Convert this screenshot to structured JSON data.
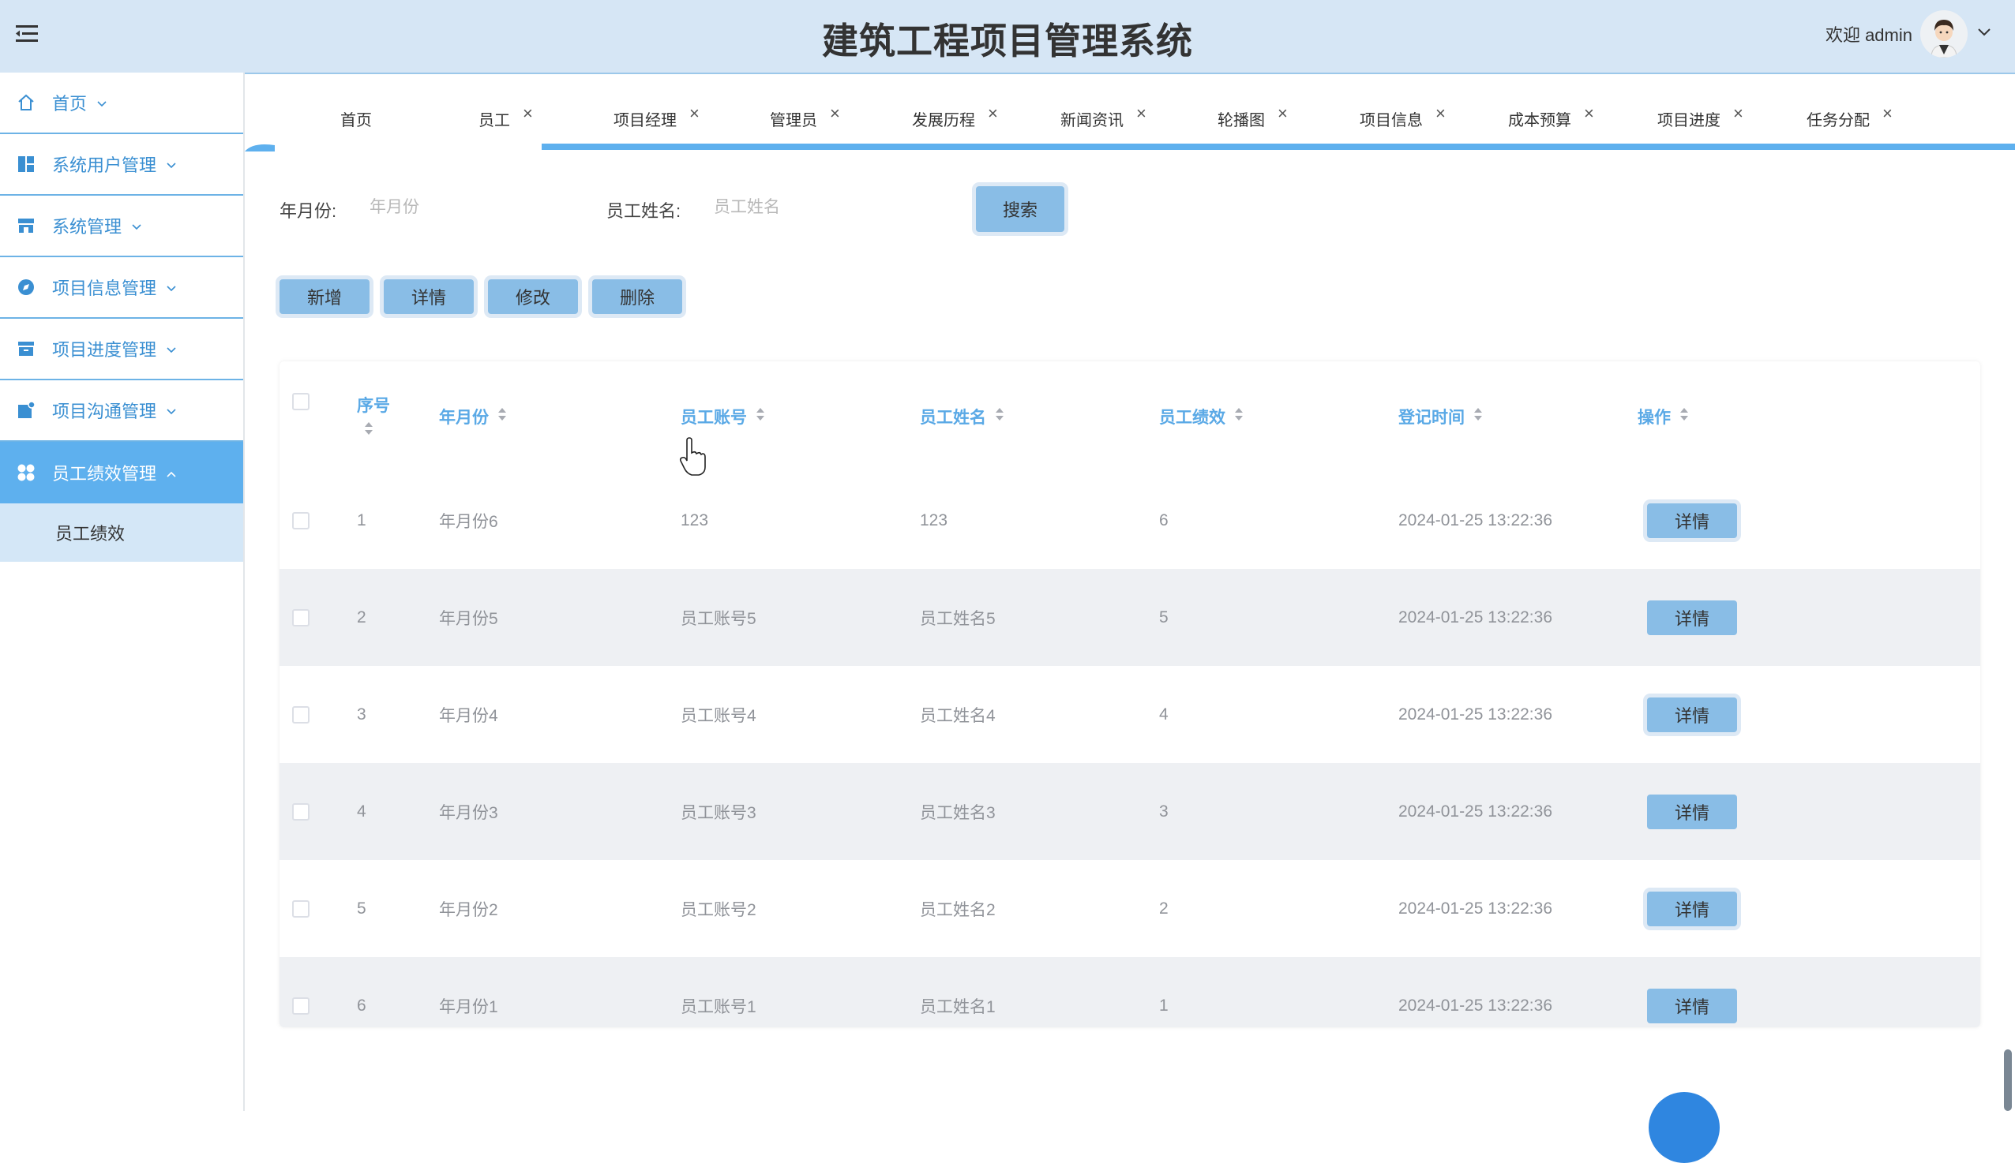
{
  "header": {
    "title": "建筑工程项目管理系统",
    "welcome": "欢迎 admin"
  },
  "sidebar": {
    "items": [
      {
        "label": "首页",
        "icon": "home-icon"
      },
      {
        "label": "系统用户管理",
        "icon": "dashboard-icon"
      },
      {
        "label": "系统管理",
        "icon": "store-icon"
      },
      {
        "label": "项目信息管理",
        "icon": "compass-icon"
      },
      {
        "label": "项目进度管理",
        "icon": "archive-icon"
      },
      {
        "label": "项目沟通管理",
        "icon": "notification-icon"
      },
      {
        "label": "员工绩效管理",
        "icon": "grid-icon"
      }
    ],
    "subitem": "员工绩效"
  },
  "tabs": [
    {
      "label": "首页"
    },
    {
      "label": "员工"
    },
    {
      "label": "项目经理"
    },
    {
      "label": "管理员"
    },
    {
      "label": "发展历程"
    },
    {
      "label": "新闻资讯"
    },
    {
      "label": "轮播图"
    },
    {
      "label": "项目信息"
    },
    {
      "label": "成本预算"
    },
    {
      "label": "项目进度"
    },
    {
      "label": "任务分配"
    }
  ],
  "tab_close": "×",
  "search": {
    "month_label": "年月份:",
    "month_placeholder": "年月份",
    "name_label": "员工姓名:",
    "name_placeholder": "员工姓名",
    "search_button": "搜索"
  },
  "actions": {
    "add": "新增",
    "detail": "详情",
    "edit": "修改",
    "delete": "删除"
  },
  "table": {
    "columns": [
      "序号",
      "年月份",
      "员工账号",
      "员工姓名",
      "员工绩效",
      "登记时间",
      "操作"
    ],
    "rows": [
      {
        "no": "1",
        "month": "年月份6",
        "account": "123",
        "name": "123",
        "score": "6",
        "time": "2024-01-25 13:22:36",
        "action": "详情"
      },
      {
        "no": "2",
        "month": "年月份5",
        "account": "员工账号5",
        "name": "员工姓名5",
        "score": "5",
        "time": "2024-01-25 13:22:36",
        "action": "详情"
      },
      {
        "no": "3",
        "month": "年月份4",
        "account": "员工账号4",
        "name": "员工姓名4",
        "score": "4",
        "time": "2024-01-25 13:22:36",
        "action": "详情"
      },
      {
        "no": "4",
        "month": "年月份3",
        "account": "员工账号3",
        "name": "员工姓名3",
        "score": "3",
        "time": "2024-01-25 13:22:36",
        "action": "详情"
      },
      {
        "no": "5",
        "month": "年月份2",
        "account": "员工账号2",
        "name": "员工姓名2",
        "score": "2",
        "time": "2024-01-25 13:22:36",
        "action": "详情"
      },
      {
        "no": "6",
        "month": "年月份1",
        "account": "员工账号1",
        "name": "员工姓名1",
        "score": "1",
        "time": "2024-01-25 13:22:36",
        "action": "详情"
      }
    ]
  },
  "colors": {
    "header_bg": "#d6e6f5",
    "accent": "#5eb0ee",
    "button": "#89bde6"
  }
}
